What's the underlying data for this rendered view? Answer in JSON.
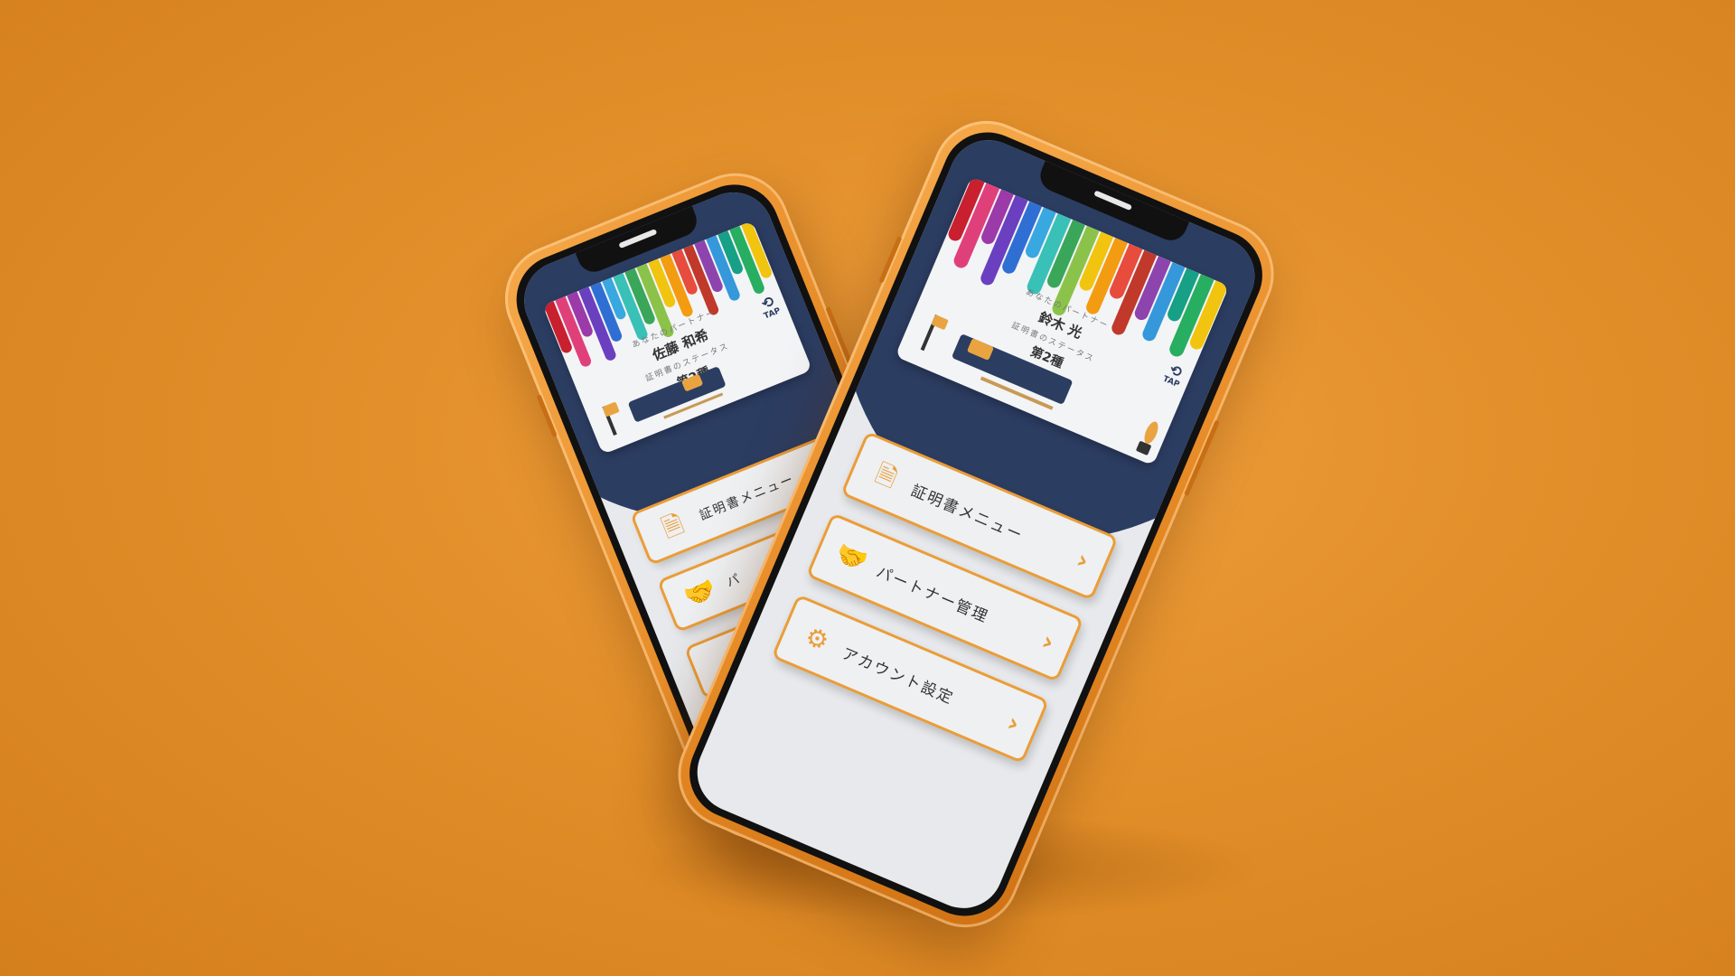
{
  "colors": {
    "background": "#e28f2a",
    "phone_body": "#e68a25",
    "accent": "#eb9d37",
    "navy": "#2c3d62",
    "screen_bg": "#e7e9ec",
    "drips": [
      "#c8202e",
      "#e0407a",
      "#9b3aa8",
      "#6a3fc0",
      "#2f6fd4",
      "#39a7e0",
      "#39c0b7",
      "#3aa65a",
      "#8bc34a",
      "#f1c40f",
      "#f39c12",
      "#e74c3c",
      "#c0392b",
      "#8e44ad",
      "#3498db",
      "#16a085",
      "#27ae60",
      "#f1c40f"
    ]
  },
  "back_phone": {
    "card": {
      "partner_label": "あなたのパートナー",
      "partner_name": "佐藤 和希",
      "status_label": "証明書のステータス",
      "status_value": "第2種",
      "tap_label": "TAP",
      "tap_icon": "refresh-arrows-icon"
    },
    "menu": [
      {
        "label": "証明書メニュー",
        "icon": "certificate-document-icon"
      },
      {
        "label": "パ",
        "icon": "handshake-icon"
      },
      {
        "label": "",
        "icon": ""
      }
    ]
  },
  "front_phone": {
    "card": {
      "partner_label": "あなたのパートナー",
      "partner_name": "鈴木 光",
      "status_label": "証明書のステータス",
      "status_value": "第2種",
      "tap_label": "TAP",
      "tap_icon": "refresh-arrows-icon"
    },
    "menu": [
      {
        "label": "証明書メニュー",
        "icon": "certificate-document-icon"
      },
      {
        "label": "パートナー管理",
        "icon": "handshake-icon"
      },
      {
        "label": "アカウント設定",
        "icon": "gear-icon"
      }
    ]
  }
}
